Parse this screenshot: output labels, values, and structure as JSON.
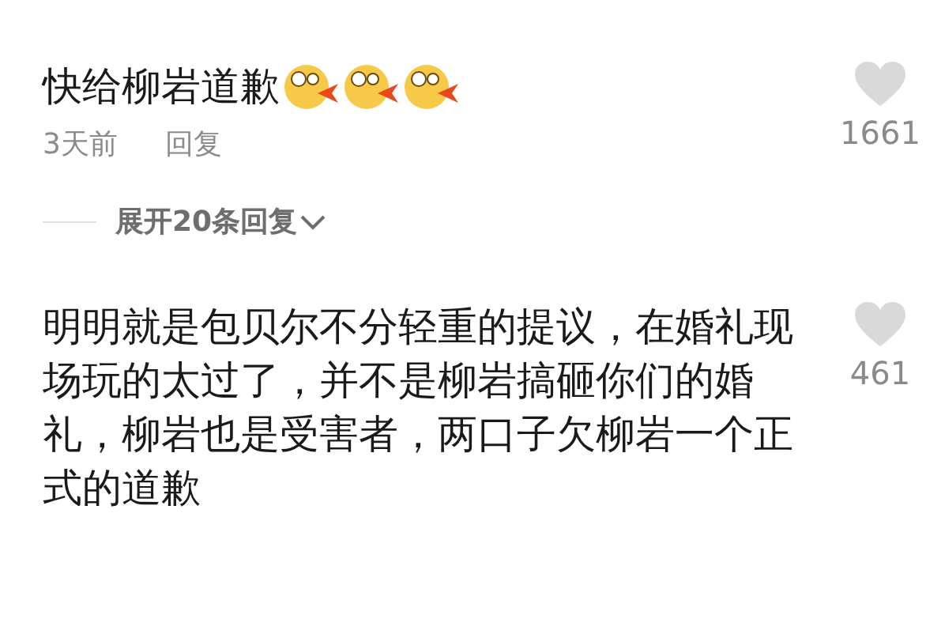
{
  "comments": [
    {
      "text": "快给柳岩道歉",
      "emojis": [
        {
          "kind": "blowing"
        },
        {
          "kind": "blowing"
        },
        {
          "kind": "blowing"
        }
      ],
      "time": "3天前",
      "reply": "回复",
      "likes": "1661",
      "expand": "展开20条回复"
    },
    {
      "text": "明明就是包贝尔不分轻重的提议，在婚礼现场玩的太过了，并不是柳岩搞砸你们的婚礼，柳岩也是受害者，两口子欠柳岩一个正式的道歉",
      "likes": "461"
    }
  ]
}
